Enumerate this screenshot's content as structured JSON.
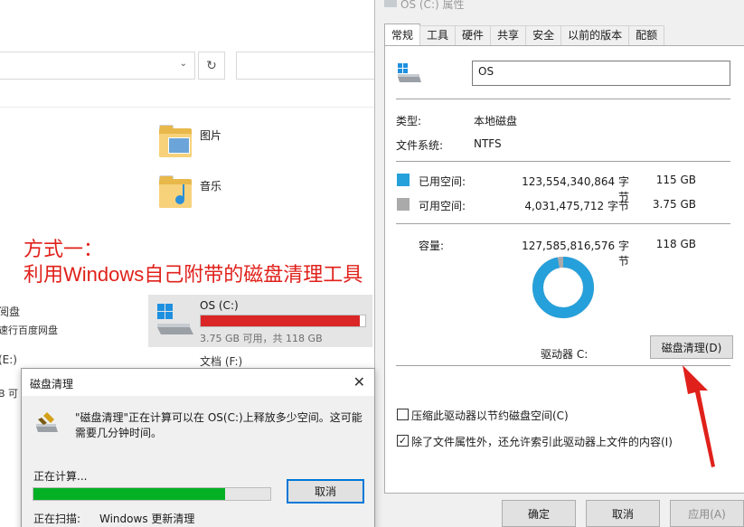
{
  "explorer": {
    "folders": [
      {
        "label": "图片"
      },
      {
        "label": "音乐"
      }
    ],
    "left_cut": [
      "阅盘",
      "速行百度网盘",
      "(E:)",
      "B 可"
    ],
    "drive_c": {
      "name": "OS (C:)",
      "free_text": "3.75 GB 可用，共 118 GB",
      "used_fraction": 0.968
    },
    "drive_f": {
      "name": "文档 (F:)"
    }
  },
  "annotation": {
    "line1": "方式一：",
    "line2": "利用Windows自己附带的磁盘清理工具",
    "color": "#e0211b"
  },
  "properties": {
    "title": "OS (C:) 属性",
    "tabs": [
      "常规",
      "工具",
      "硬件",
      "共享",
      "安全",
      "以前的版本",
      "配额"
    ],
    "active_tab": "常规",
    "name_value": "OS",
    "type_label": "类型:",
    "type_value": "本地磁盘",
    "fs_label": "文件系统:",
    "fs_value": "NTFS",
    "used": {
      "label": "已用空间:",
      "bytes": "123,554,340,864 字节",
      "size": "115 GB",
      "color": "#26a0da"
    },
    "free": {
      "label": "可用空间:",
      "bytes": "4,031,475,712 字节",
      "size": "3.75 GB",
      "color": "#aaaaaa"
    },
    "capacity": {
      "label": "容量:",
      "bytes": "127,585,816,576 字节",
      "size": "118 GB"
    },
    "drive_label": "驱动器 C:",
    "cleanup_button": "磁盘清理(D)",
    "compress": {
      "label": "压缩此驱动器以节约磁盘空间(C)",
      "checked": false
    },
    "index": {
      "label": "除了文件属性外，还允许索引此驱动器上文件的内容(I)",
      "checked": true
    },
    "buttons": {
      "ok": "确定",
      "cancel": "取消",
      "apply": "应用(A)"
    }
  },
  "disk_cleanup": {
    "title": "磁盘清理",
    "message": "\"磁盘清理\"正在计算可以在 OS(C:)上释放多少空间。这可能需要几分钟时间。",
    "calculating": "正在计算...",
    "progress": 0.81,
    "cancel": "取消",
    "scanning_label": "正在扫描:",
    "scanning_value": "Windows 更新清理"
  }
}
